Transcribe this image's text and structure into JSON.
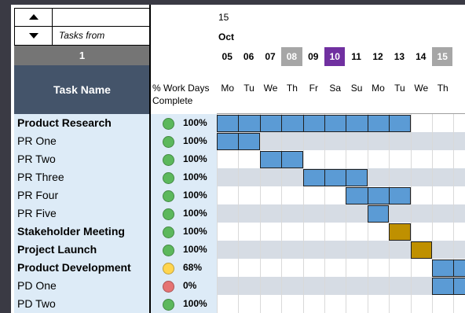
{
  "controls": {
    "tasks_from_label": "Tasks from",
    "start_step": "1"
  },
  "columns": {
    "task_name": "Task Name",
    "pct_complete": "% Work Days Complete"
  },
  "timeline": {
    "year_label": "15",
    "month_label": "Oct",
    "dates": [
      {
        "label": "05",
        "style": "normal"
      },
      {
        "label": "06",
        "style": "normal"
      },
      {
        "label": "07",
        "style": "normal"
      },
      {
        "label": "08",
        "style": "weekend"
      },
      {
        "label": "09",
        "style": "normal"
      },
      {
        "label": "10",
        "style": "today"
      },
      {
        "label": "11",
        "style": "normal"
      },
      {
        "label": "12",
        "style": "normal"
      },
      {
        "label": "13",
        "style": "normal"
      },
      {
        "label": "14",
        "style": "normal"
      },
      {
        "label": "15",
        "style": "weekend"
      }
    ],
    "days": [
      "Mo",
      "Tu",
      "We",
      "Th",
      "Fr",
      "Sa",
      "Su",
      "Mo",
      "Tu",
      "We",
      "Th"
    ]
  },
  "tasks": [
    {
      "name": "Product Research",
      "bold": true,
      "pct": "100%",
      "status": "green",
      "bar_start": 0,
      "bar_len": 9,
      "bar_color": "blue"
    },
    {
      "name": "PR One",
      "bold": false,
      "pct": "100%",
      "status": "green",
      "bar_start": 0,
      "bar_len": 2,
      "bar_color": "blue"
    },
    {
      "name": "PR Two",
      "bold": false,
      "pct": "100%",
      "status": "green",
      "bar_start": 2,
      "bar_len": 2,
      "bar_color": "blue"
    },
    {
      "name": "PR Three",
      "bold": false,
      "pct": "100%",
      "status": "green",
      "bar_start": 4,
      "bar_len": 3,
      "bar_color": "blue"
    },
    {
      "name": "PR Four",
      "bold": false,
      "pct": "100%",
      "status": "green",
      "bar_start": 6,
      "bar_len": 3,
      "bar_color": "blue"
    },
    {
      "name": "PR Five",
      "bold": false,
      "pct": "100%",
      "status": "green",
      "bar_start": 7,
      "bar_len": 1,
      "bar_color": "blue"
    },
    {
      "name": "Stakeholder Meeting",
      "bold": true,
      "pct": "100%",
      "status": "green",
      "bar_start": 8,
      "bar_len": 1,
      "bar_color": "gold"
    },
    {
      "name": "Project Launch",
      "bold": true,
      "pct": "100%",
      "status": "green",
      "bar_start": 9,
      "bar_len": 1,
      "bar_color": "gold"
    },
    {
      "name": "Product Development",
      "bold": true,
      "pct": "68%",
      "status": "yellow",
      "bar_start": 10,
      "bar_len": 2,
      "bar_color": "blue"
    },
    {
      "name": "PD One",
      "bold": false,
      "pct": "0%",
      "status": "red",
      "bar_start": 10,
      "bar_len": 2,
      "bar_color": "blue"
    },
    {
      "name": "PD Two",
      "bold": false,
      "pct": "100%",
      "status": "green",
      "bar_start": null,
      "bar_len": 0,
      "bar_color": "blue"
    }
  ],
  "colors": {
    "blue": "#5b9bd5",
    "gold": "#bf9000",
    "green": "#5cb85c",
    "yellow": "#ffd54f",
    "red": "#e57373",
    "weekend_bg": "#a6a6a6",
    "today_bg": "#7030a0",
    "header_dark": "#44546a",
    "task_col_bg": "#ddebf7",
    "stripe": "#d6dce4"
  }
}
